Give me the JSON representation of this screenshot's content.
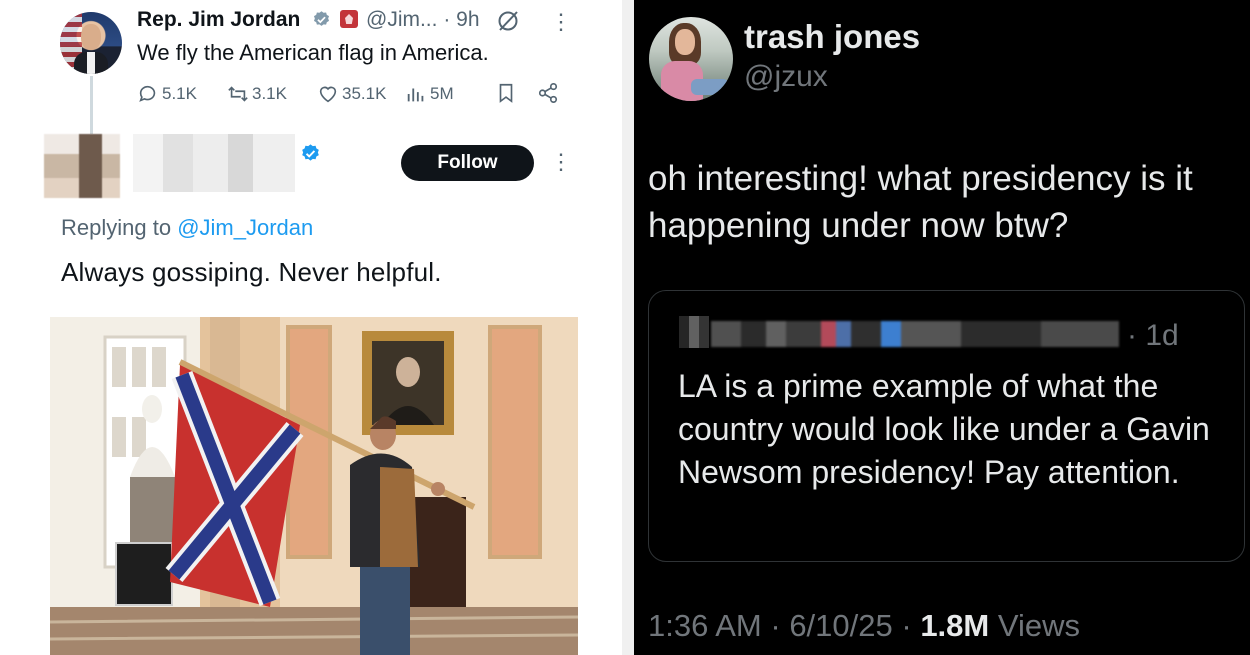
{
  "left_tweet": {
    "author_name": "Rep. Jim Jordan",
    "author_handle": "@Jim...",
    "time": "· 9h",
    "text": "We fly the American flag in America.",
    "stats": {
      "replies": "5.1K",
      "reposts": "3.1K",
      "likes": "35.1K",
      "views": "5M"
    }
  },
  "reply": {
    "follow_label": "Follow",
    "replying_prefix": "Replying to",
    "replying_to": "@Jim_Jordan",
    "text": "Always gossiping. Never helpful."
  },
  "right_tweet": {
    "author_name": "trash jones",
    "author_handle": "@jzux",
    "text": "oh interesting! what presidency is it happening under now btw?",
    "quote": {
      "time": "· 1d",
      "text": "LA is a prime example of what the country would look like under a Gavin Newsom presidency!  Pay attention."
    },
    "meta": {
      "time": "1:36 AM",
      "sep1": " · ",
      "date": "6/10/25",
      "sep2": " · ",
      "views_count": "1.8M",
      "views_label": " Views"
    }
  },
  "colors": {
    "verified_blue": "#1d9bf0",
    "link_blue": "#1d9bf0",
    "dark_bg": "#000000",
    "follow_button": "#0f1419"
  }
}
